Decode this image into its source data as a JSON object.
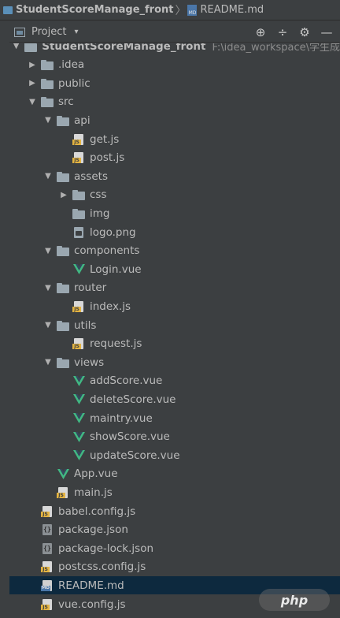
{
  "breadcrumb": {
    "project": "StudentScoreManage_front",
    "file": "README.md"
  },
  "toolwindow": {
    "title": "Project",
    "chevron": "▾",
    "actions": [
      {
        "icon": "crosshair-icon",
        "glyph": "⊕"
      },
      {
        "icon": "collapse-icon",
        "glyph": "÷"
      },
      {
        "icon": "gear-icon",
        "glyph": "⚙"
      },
      {
        "icon": "minimize-icon",
        "glyph": "—"
      }
    ]
  },
  "tree": {
    "rows": [
      {
        "label": "StudentScoreManage_front",
        "path": "F:\\idea_workspace\\学生成",
        "icon": "folder",
        "expanded": true,
        "depth": 0
      },
      {
        "label": ".idea",
        "icon": "folder",
        "expanded": false,
        "depth": 1
      },
      {
        "label": "public",
        "icon": "folder",
        "expanded": false,
        "depth": 1
      },
      {
        "label": "src",
        "icon": "folder",
        "expanded": true,
        "depth": 1
      },
      {
        "label": "api",
        "icon": "folder",
        "expanded": true,
        "depth": 2
      },
      {
        "label": "get.js",
        "icon": "js",
        "depth": 3
      },
      {
        "label": "post.js",
        "icon": "js",
        "depth": 3
      },
      {
        "label": "assets",
        "icon": "folder",
        "expanded": true,
        "depth": 2
      },
      {
        "label": "css",
        "icon": "folder",
        "expanded": false,
        "depth": 3
      },
      {
        "label": "img",
        "icon": "folder",
        "depth": 3
      },
      {
        "label": "logo.png",
        "icon": "image",
        "depth": 3
      },
      {
        "label": "components",
        "icon": "folder",
        "expanded": true,
        "depth": 2
      },
      {
        "label": "Login.vue",
        "icon": "vue",
        "depth": 3
      },
      {
        "label": "router",
        "icon": "folder",
        "expanded": true,
        "depth": 2
      },
      {
        "label": "index.js",
        "icon": "js",
        "depth": 3
      },
      {
        "label": "utils",
        "icon": "folder",
        "expanded": true,
        "depth": 2
      },
      {
        "label": "request.js",
        "icon": "js",
        "depth": 3
      },
      {
        "label": "views",
        "icon": "folder",
        "expanded": true,
        "depth": 2
      },
      {
        "label": "addScore.vue",
        "icon": "vue",
        "depth": 3
      },
      {
        "label": "deleteScore.vue",
        "icon": "vue",
        "depth": 3
      },
      {
        "label": "maintry.vue",
        "icon": "vue",
        "depth": 3
      },
      {
        "label": "showScore.vue",
        "icon": "vue",
        "depth": 3
      },
      {
        "label": "updateScore.vue",
        "icon": "vue",
        "depth": 3
      },
      {
        "label": "App.vue",
        "icon": "vue",
        "depth": 2
      },
      {
        "label": "main.js",
        "icon": "js",
        "depth": 2
      },
      {
        "label": "babel.config.js",
        "icon": "js",
        "depth": 1
      },
      {
        "label": "package.json",
        "icon": "json",
        "depth": 1
      },
      {
        "label": "package-lock.json",
        "icon": "json",
        "depth": 1
      },
      {
        "label": "postcss.config.js",
        "icon": "js",
        "depth": 1
      },
      {
        "label": "README.md",
        "icon": "md",
        "depth": 1,
        "selected": true
      },
      {
        "label": "vue.config.js",
        "icon": "js",
        "depth": 1
      }
    ]
  },
  "watermark": {
    "text": "php"
  },
  "colors": {
    "background": "#3c3f41",
    "text": "#bbbbbb",
    "selection": "#0d293e",
    "vue_green": "#41b883",
    "js_yellow": "#e3b341",
    "folder_grey": "#9aa7b0"
  }
}
